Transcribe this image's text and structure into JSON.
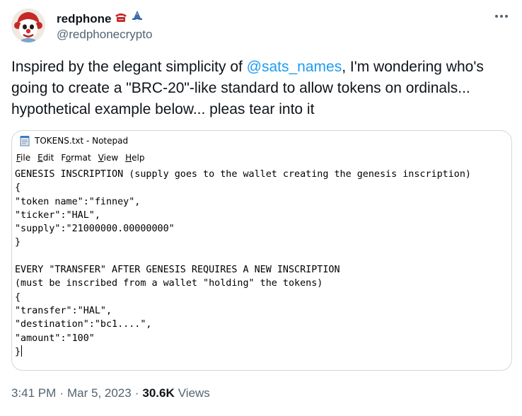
{
  "author": {
    "display_name": "redphone",
    "handle": "@redphonecrypto",
    "badges": [
      "telephone-icon",
      "wizard-icon"
    ]
  },
  "tweet": {
    "text_prefix": "Inspired by the elegant simplicity of ",
    "mention": "@sats_names",
    "text_suffix": ", I'm wondering who's going to create a \"BRC-20\"-like standard to allow tokens on ordinals... hypothetical example below... pleas tear into it"
  },
  "notepad": {
    "title": "TOKENS.txt - Notepad",
    "menu": [
      {
        "u": "F",
        "rest": "ile"
      },
      {
        "u": "E",
        "rest": "dit"
      },
      {
        "u": "F",
        "rest": "o",
        "pre": "",
        "alt": "Format"
      },
      {
        "u": "V",
        "rest": "iew"
      },
      {
        "u": "H",
        "rest": "elp"
      }
    ],
    "menu_labels": [
      "File",
      "Edit",
      "Format",
      "View",
      "Help"
    ],
    "content": "GENESIS INSCRIPTION (supply goes to the wallet creating the genesis inscription)\n{\n\"token name\":\"finney\",\n\"ticker\":\"HAL\",\n\"supply\":\"21000000.00000000\"\n}\n\nEVERY \"TRANSFER\" AFTER GENESIS REQUIRES A NEW INSCRIPTION\n(must be inscribed from a wallet \"holding\" the tokens)\n{\n\"transfer\":\"HAL\",\n\"destination\":\"bc1....\",\n\"amount\":\"100\"\n}"
  },
  "meta": {
    "time": "3:41 PM",
    "date": "Mar 5, 2023",
    "separator": "·",
    "views_count": "30.6K",
    "views_label": "Views"
  },
  "colors": {
    "link": "#1d9bf0",
    "secondary_text": "#536471",
    "primary_text": "#0f1419",
    "border": "#cfd9de"
  }
}
